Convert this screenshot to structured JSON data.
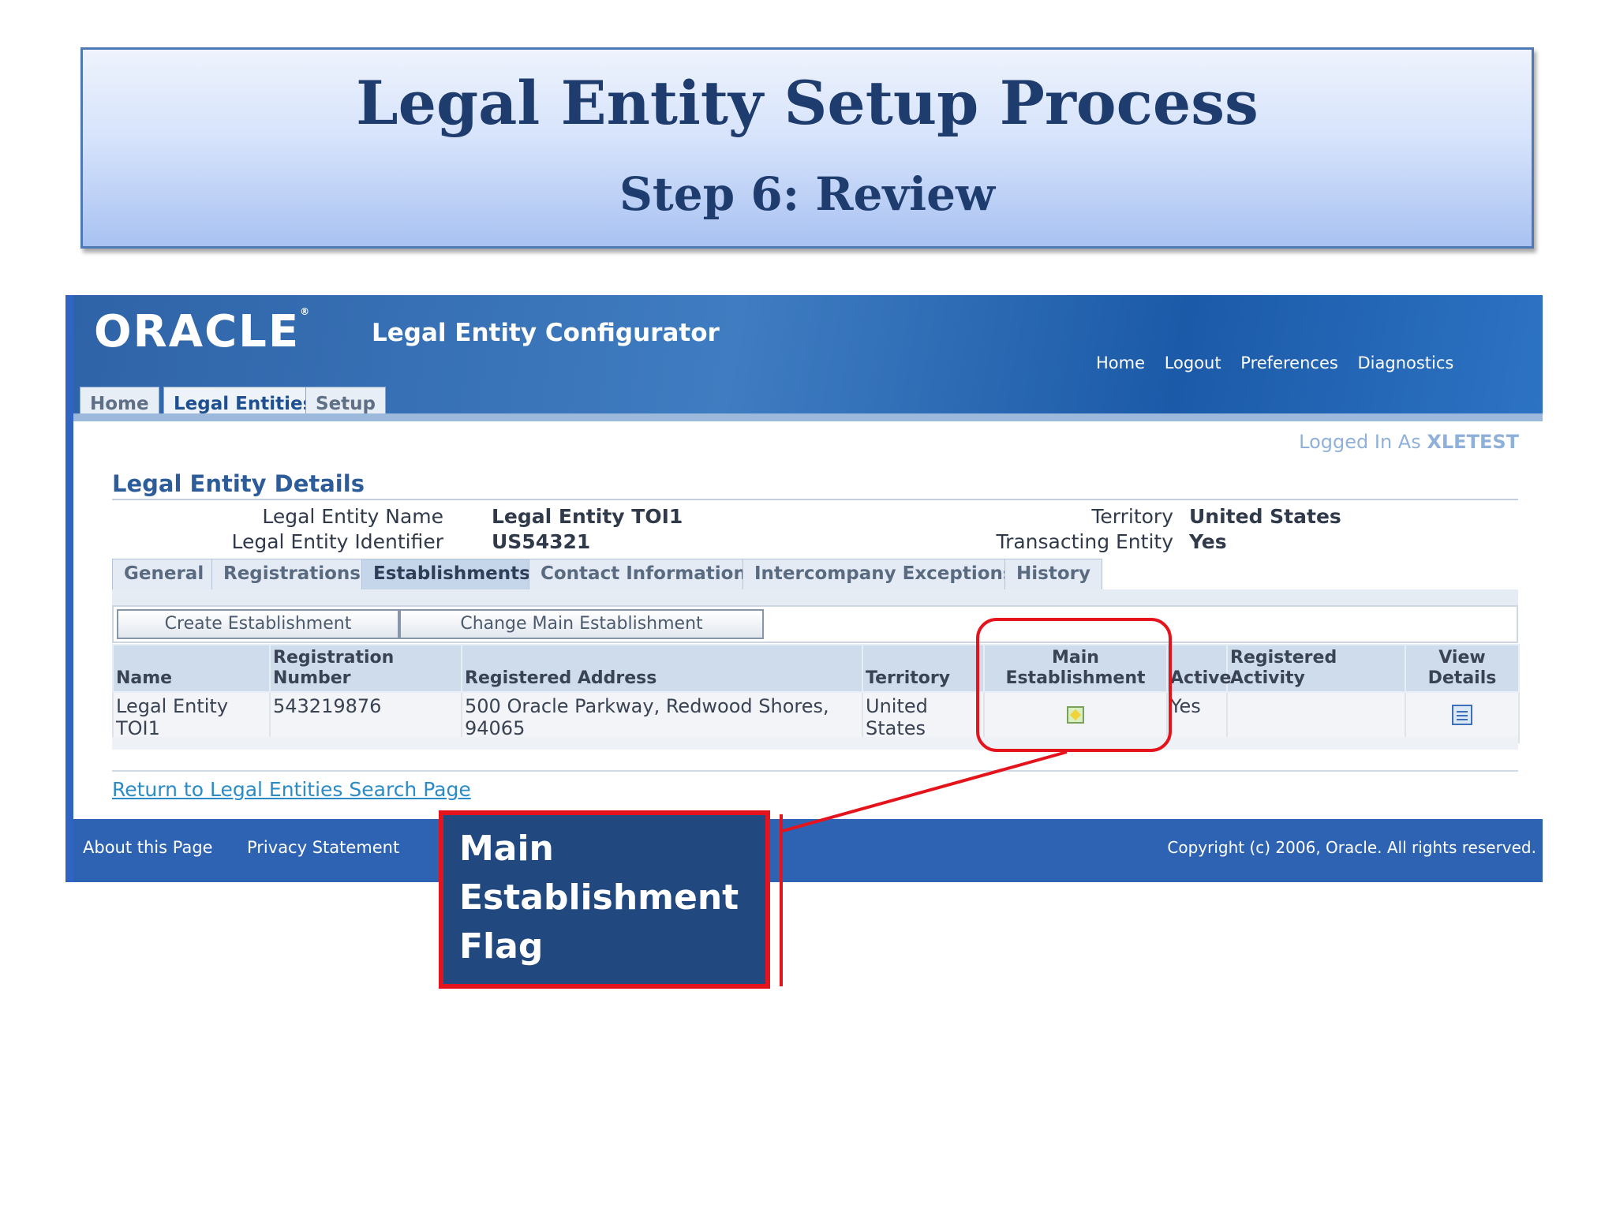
{
  "slide": {
    "title": "Legal Entity Setup Process",
    "subtitle": "Step 6: Review"
  },
  "app": {
    "logo": "ORACLE",
    "name": "Legal Entity Configurator",
    "global_links": [
      "Home",
      "Logout",
      "Preferences",
      "Diagnostics"
    ],
    "tabs": [
      "Home",
      "Legal Entities",
      "Setup"
    ],
    "active_tab": "Legal Entities",
    "logged_in_prefix": "Logged In As",
    "logged_in_user": "XLETEST"
  },
  "details": {
    "section_title": "Legal Entity Details",
    "fields": {
      "name_label": "Legal Entity Name",
      "name_value": "Legal Entity TOI1",
      "id_label": "Legal Entity Identifier",
      "id_value": "US54321",
      "territory_label": "Territory",
      "territory_value": "United States",
      "transacting_label": "Transacting Entity",
      "transacting_value": "Yes"
    },
    "subtabs": [
      "General",
      "Registrations",
      "Establishments",
      "Contact Information",
      "Intercompany Exceptions",
      "History"
    ],
    "active_subtab": "Establishments"
  },
  "establishments": {
    "buttons": [
      "Create Establishment",
      "Change Main Establishment"
    ],
    "columns": [
      "Name",
      "Registration Number",
      "Registered Address",
      "Territory",
      "Main Establishment",
      "Active",
      "Registered Activity",
      "View Details"
    ],
    "rows": [
      {
        "name": "Legal Entity TOI1",
        "registration_number": "543219876",
        "registered_address": "500 Oracle Parkway, Redwood Shores, 94065",
        "territory": "United States",
        "main_establishment_icon": "main-establishment-flag-icon",
        "active": "Yes",
        "registered_activity": "",
        "view_details_icon": "view-details-icon"
      }
    ]
  },
  "return_link": "Return to Legal Entities Search Page",
  "footer": {
    "links": [
      "About this Page",
      "Privacy Statement"
    ],
    "copyright": "Copyright (c) 2006, Oracle. All rights reserved."
  },
  "callout": {
    "lines": [
      "Main",
      "Establishment",
      "Flag"
    ],
    "color": "#e5141c"
  }
}
